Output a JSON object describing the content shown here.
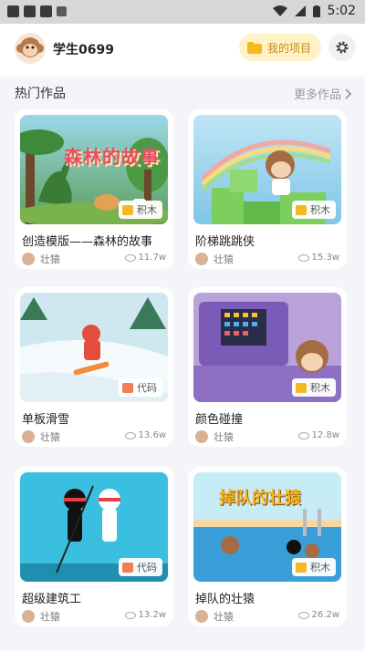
{
  "status": {
    "time": "5:02"
  },
  "header": {
    "username": "学生0699",
    "projects_label": "我的项目"
  },
  "section": {
    "title": "热门作品",
    "more_label": "更多作品"
  },
  "cards": [
    {
      "title": "创造模版——森林的故事",
      "tag": "积木",
      "author": "壮猿",
      "views": "11.7w"
    },
    {
      "title": "阶梯跳跳侠",
      "tag": "积木",
      "author": "壮猿",
      "views": "15.3w"
    },
    {
      "title": "单板滑雪",
      "tag": "代码",
      "author": "壮猿",
      "views": "13.6w"
    },
    {
      "title": "颜色碰撞",
      "tag": "积木",
      "author": "壮猿",
      "views": "12.8w"
    },
    {
      "title": "超级建筑工",
      "tag": "代码",
      "author": "壮猿",
      "views": "13.2w"
    },
    {
      "title": "掉队的壮猿",
      "tag": "积木",
      "author": "壮猿",
      "views": "26.2w"
    }
  ],
  "thumb_text": {
    "forest": "森林的故事",
    "pool": "掉队的壮猿"
  },
  "colors": {
    "block_tag": "#f5b820",
    "code_tag": "#f07f56",
    "accent": "#f5b820"
  }
}
